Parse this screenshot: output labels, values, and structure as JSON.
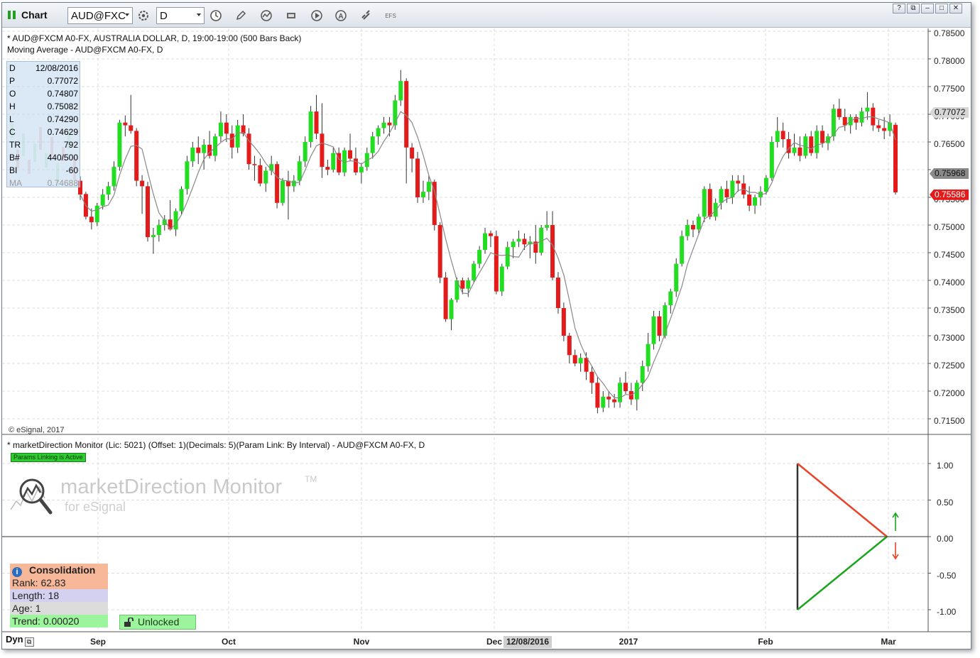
{
  "toolbar": {
    "title": "Chart",
    "symbol_value": "AUD@FXC",
    "interval_value": "D",
    "efs_label": "EFS"
  },
  "price_pane": {
    "header_line1": "* AUD@FXCM A0-FX, AUSTRALIA DOLLAR, D, 19:00-19:00 (500 Bars Back)",
    "header_line2": "Moving Average - AUD@FXCM A0-FX, D",
    "copyright": "© eSignal, 2017",
    "y_axis_labels": [
      "0.78500",
      "0.78000",
      "0.77500",
      "0.77000",
      "0.76500",
      "0.76000",
      "0.75500",
      "0.75000",
      "0.74500",
      "0.74000",
      "0.73500",
      "0.73000",
      "0.72500",
      "0.72000",
      "0.71500"
    ],
    "price_tags": [
      {
        "text": "0.77072",
        "bg": "#d6d6d6",
        "fg": "#111111"
      },
      {
        "text": "0.75968",
        "bg": "#8a8a8a",
        "fg": "#111111"
      },
      {
        "text": "0.75586",
        "bg": "#e41b1b",
        "fg": "#ffffff"
      }
    ]
  },
  "data_window": [
    {
      "k": "D",
      "v": "12/08/2016"
    },
    {
      "k": "P",
      "v": "0.77072"
    },
    {
      "k": "O",
      "v": "0.74807"
    },
    {
      "k": "H",
      "v": "0.75082"
    },
    {
      "k": "L",
      "v": "0.74290"
    },
    {
      "k": "C",
      "v": "0.74629"
    },
    {
      "k": "TR",
      "v": "792"
    },
    {
      "k": "B#",
      "v": "440/500"
    },
    {
      "k": "BI",
      "v": "-60"
    },
    {
      "k": "MA",
      "v": "0.74688"
    }
  ],
  "indicator_pane": {
    "header": "* marketDirection Monitor (Lic: 5021) (Offset: 1)(Decimals: 5)(Param Link: By Interval) - AUD@FXCM A0-FX, D",
    "badge": "Params Linking is Active",
    "logo_title": "marketDirection Monitor",
    "logo_tm": "TM",
    "logo_sub": "for eSignal",
    "y_axis_labels": [
      "1.00",
      "0.50",
      "0.00",
      "-0.50",
      "-1.00"
    ],
    "info_title": "Consolidation",
    "info_rows": [
      {
        "text": "Rank: 62.83",
        "bg": "#f7b89a"
      },
      {
        "text": "Length: 18",
        "bg": "#d4d0f0"
      },
      {
        "text": "Age: 1",
        "bg": "#dcdcdc"
      },
      {
        "text": "Trend: 0.00020",
        "bg": "#9cf59c"
      }
    ],
    "unlock_label": "Unlocked"
  },
  "x_axis": {
    "mode": "Dyn",
    "labels": [
      "Sep",
      "Oct",
      "Nov",
      "Dec",
      "2017",
      "Feb",
      "Mar"
    ],
    "crosshair_date": "12/08/2016"
  },
  "colors": {
    "up": "#22dd22",
    "down": "#e41b1b",
    "grid": "#dcdcdc"
  },
  "chart_data": {
    "type": "candlestick",
    "symbol": "AUD@FXCM A0-FX",
    "ylim": [
      0.713,
      0.787
    ],
    "ohlc": [
      [
        0.758,
        0.7588,
        0.7545,
        0.7555
      ],
      [
        0.7556,
        0.756,
        0.751,
        0.7515
      ],
      [
        0.7515,
        0.753,
        0.7492,
        0.7505
      ],
      [
        0.7505,
        0.754,
        0.7498,
        0.7535
      ],
      [
        0.7535,
        0.7565,
        0.7528,
        0.7555
      ],
      [
        0.7555,
        0.7578,
        0.7545,
        0.757
      ],
      [
        0.757,
        0.7615,
        0.7562,
        0.7605
      ],
      [
        0.7605,
        0.769,
        0.7598,
        0.7685
      ],
      [
        0.7685,
        0.7698,
        0.766,
        0.768
      ],
      [
        0.768,
        0.7735,
        0.7665,
        0.767
      ],
      [
        0.767,
        0.7675,
        0.757,
        0.758
      ],
      [
        0.758,
        0.759,
        0.752,
        0.757
      ],
      [
        0.757,
        0.7578,
        0.747,
        0.7478
      ],
      [
        0.7478,
        0.7495,
        0.7448,
        0.7482
      ],
      [
        0.7482,
        0.751,
        0.747,
        0.75
      ],
      [
        0.75,
        0.7518,
        0.749,
        0.751
      ],
      [
        0.751,
        0.7545,
        0.749,
        0.7492
      ],
      [
        0.7492,
        0.753,
        0.748,
        0.7525
      ],
      [
        0.7525,
        0.757,
        0.7518,
        0.7565
      ],
      [
        0.7565,
        0.7625,
        0.7555,
        0.7615
      ],
      [
        0.7615,
        0.765,
        0.7605,
        0.764
      ],
      [
        0.764,
        0.766,
        0.761,
        0.763
      ],
      [
        0.763,
        0.7655,
        0.76,
        0.7645
      ],
      [
        0.7645,
        0.767,
        0.762,
        0.7625
      ],
      [
        0.7625,
        0.7665,
        0.7615,
        0.766
      ],
      [
        0.766,
        0.7705,
        0.765,
        0.7685
      ],
      [
        0.7685,
        0.77,
        0.765,
        0.7665
      ],
      [
        0.7665,
        0.768,
        0.762,
        0.764
      ],
      [
        0.764,
        0.769,
        0.763,
        0.768
      ],
      [
        0.768,
        0.77,
        0.766,
        0.7665
      ],
      [
        0.7665,
        0.7675,
        0.76,
        0.761
      ],
      [
        0.761,
        0.7625,
        0.758,
        0.7608
      ],
      [
        0.7608,
        0.762,
        0.757,
        0.7575
      ],
      [
        0.7575,
        0.7605,
        0.756,
        0.7598
      ],
      [
        0.7598,
        0.7625,
        0.759,
        0.761
      ],
      [
        0.761,
        0.7615,
        0.753,
        0.754
      ],
      [
        0.754,
        0.7585,
        0.7535,
        0.758
      ],
      [
        0.758,
        0.7598,
        0.751,
        0.757
      ],
      [
        0.757,
        0.759,
        0.756,
        0.758
      ],
      [
        0.758,
        0.7625,
        0.7572,
        0.7615
      ],
      [
        0.7615,
        0.766,
        0.7605,
        0.765
      ],
      [
        0.765,
        0.7715,
        0.764,
        0.7705
      ],
      [
        0.7705,
        0.7735,
        0.7655,
        0.7665
      ],
      [
        0.7665,
        0.772,
        0.7585,
        0.7605
      ],
      [
        0.7605,
        0.7618,
        0.759,
        0.76
      ],
      [
        0.76,
        0.764,
        0.7595,
        0.763
      ],
      [
        0.763,
        0.764,
        0.759,
        0.7595
      ],
      [
        0.7595,
        0.764,
        0.7588,
        0.7635
      ],
      [
        0.7635,
        0.7665,
        0.7615,
        0.762
      ],
      [
        0.762,
        0.764,
        0.759,
        0.7595
      ],
      [
        0.7595,
        0.7612,
        0.7575,
        0.7605
      ],
      [
        0.7605,
        0.764,
        0.7598,
        0.763
      ],
      [
        0.763,
        0.7668,
        0.762,
        0.766
      ],
      [
        0.766,
        0.768,
        0.7645,
        0.7675
      ],
      [
        0.7675,
        0.7695,
        0.7665,
        0.7685
      ],
      [
        0.7685,
        0.7695,
        0.766,
        0.768
      ],
      [
        0.768,
        0.7735,
        0.7672,
        0.7725
      ],
      [
        0.7725,
        0.778,
        0.7715,
        0.776
      ],
      [
        0.776,
        0.7765,
        0.7575,
        0.764
      ],
      [
        0.764,
        0.7648,
        0.7595,
        0.762
      ],
      [
        0.762,
        0.7632,
        0.754,
        0.755
      ],
      [
        0.755,
        0.758,
        0.754,
        0.756
      ],
      [
        0.756,
        0.759,
        0.7545,
        0.7578
      ],
      [
        0.7578,
        0.7582,
        0.749,
        0.75
      ],
      [
        0.75,
        0.7505,
        0.7395,
        0.7405
      ],
      [
        0.7405,
        0.7415,
        0.7325,
        0.733
      ],
      [
        0.733,
        0.7368,
        0.731,
        0.7365
      ],
      [
        0.7365,
        0.7405,
        0.736,
        0.74
      ],
      [
        0.74,
        0.7405,
        0.7375,
        0.7385
      ],
      [
        0.7385,
        0.7405,
        0.737,
        0.74
      ],
      [
        0.74,
        0.7435,
        0.7395,
        0.743
      ],
      [
        0.743,
        0.7462,
        0.7422,
        0.7455
      ],
      [
        0.7455,
        0.7495,
        0.7448,
        0.7485
      ],
      [
        0.7485,
        0.749,
        0.746,
        0.748
      ],
      [
        0.748,
        0.749,
        0.7375,
        0.738
      ],
      [
        0.738,
        0.743,
        0.7372,
        0.7425
      ],
      [
        0.7425,
        0.747,
        0.742,
        0.746
      ],
      [
        0.746,
        0.7475,
        0.744,
        0.747
      ],
      [
        0.747,
        0.749,
        0.746,
        0.7475
      ],
      [
        0.7475,
        0.7485,
        0.7455,
        0.7465
      ],
      [
        0.7465,
        0.748,
        0.744,
        0.747
      ],
      [
        0.747,
        0.75,
        0.743,
        0.745
      ],
      [
        0.745,
        0.75,
        0.7445,
        0.7495
      ],
      [
        0.7495,
        0.7525,
        0.749,
        0.75
      ],
      [
        0.75,
        0.7525,
        0.74,
        0.7405
      ],
      [
        0.7405,
        0.7415,
        0.734,
        0.735
      ],
      [
        0.735,
        0.736,
        0.729,
        0.73
      ],
      [
        0.73,
        0.7305,
        0.725,
        0.7265
      ],
      [
        0.7265,
        0.7275,
        0.7245,
        0.725
      ],
      [
        0.725,
        0.7268,
        0.7235,
        0.726
      ],
      [
        0.726,
        0.727,
        0.722,
        0.7235
      ],
      [
        0.7235,
        0.7245,
        0.7195,
        0.7215
      ],
      [
        0.7215,
        0.7225,
        0.716,
        0.717
      ],
      [
        0.717,
        0.72,
        0.7162,
        0.719
      ],
      [
        0.719,
        0.72,
        0.717,
        0.7185
      ],
      [
        0.7185,
        0.7195,
        0.717,
        0.718
      ],
      [
        0.718,
        0.7225,
        0.717,
        0.7215
      ],
      [
        0.7215,
        0.7235,
        0.7195,
        0.72
      ],
      [
        0.72,
        0.7215,
        0.7175,
        0.7185
      ],
      [
        0.7185,
        0.722,
        0.7165,
        0.7215
      ],
      [
        0.7215,
        0.7255,
        0.72,
        0.7245
      ],
      [
        0.7245,
        0.7305,
        0.7235,
        0.7285
      ],
      [
        0.7285,
        0.7345,
        0.7275,
        0.7335
      ],
      [
        0.7335,
        0.7345,
        0.729,
        0.73
      ],
      [
        0.73,
        0.736,
        0.7295,
        0.7355
      ],
      [
        0.7355,
        0.7385,
        0.734,
        0.738
      ],
      [
        0.738,
        0.744,
        0.737,
        0.743
      ],
      [
        0.743,
        0.749,
        0.7425,
        0.748
      ],
      [
        0.748,
        0.751,
        0.7472,
        0.75
      ],
      [
        0.75,
        0.7508,
        0.7478,
        0.7492
      ],
      [
        0.7492,
        0.752,
        0.7485,
        0.7515
      ],
      [
        0.7515,
        0.757,
        0.7505,
        0.7565
      ],
      [
        0.7565,
        0.7575,
        0.751,
        0.7515
      ],
      [
        0.7515,
        0.7548,
        0.7508,
        0.754
      ],
      [
        0.754,
        0.757,
        0.7528,
        0.7565
      ],
      [
        0.7565,
        0.758,
        0.754,
        0.755
      ],
      [
        0.755,
        0.759,
        0.7538,
        0.758
      ],
      [
        0.758,
        0.759,
        0.756,
        0.7575
      ],
      [
        0.7575,
        0.759,
        0.7548,
        0.7555
      ],
      [
        0.7555,
        0.757,
        0.7525,
        0.7535
      ],
      [
        0.7535,
        0.7555,
        0.752,
        0.755
      ],
      [
        0.755,
        0.757,
        0.7535,
        0.756
      ],
      [
        0.756,
        0.759,
        0.7555,
        0.7585
      ],
      [
        0.7585,
        0.766,
        0.758,
        0.765
      ],
      [
        0.765,
        0.7695,
        0.764,
        0.767
      ],
      [
        0.767,
        0.7685,
        0.764,
        0.7655
      ],
      [
        0.7655,
        0.7668,
        0.762,
        0.763
      ],
      [
        0.763,
        0.7665,
        0.7625,
        0.764
      ],
      [
        0.764,
        0.766,
        0.7615,
        0.7625
      ],
      [
        0.7625,
        0.7665,
        0.762,
        0.766
      ],
      [
        0.766,
        0.767,
        0.7625,
        0.763
      ],
      [
        0.763,
        0.768,
        0.762,
        0.767
      ],
      [
        0.767,
        0.768,
        0.764,
        0.7648
      ],
      [
        0.7648,
        0.7665,
        0.7635,
        0.766
      ],
      [
        0.766,
        0.7718,
        0.7652,
        0.771
      ],
      [
        0.771,
        0.7728,
        0.769,
        0.7695
      ],
      [
        0.7695,
        0.771,
        0.767,
        0.768
      ],
      [
        0.768,
        0.77,
        0.7665,
        0.7695
      ],
      [
        0.7695,
        0.77,
        0.7672,
        0.7685
      ],
      [
        0.7685,
        0.7712,
        0.7678,
        0.7705
      ],
      [
        0.7705,
        0.774,
        0.769,
        0.7712
      ],
      [
        0.7712,
        0.772,
        0.767,
        0.768
      ],
      [
        0.768,
        0.769,
        0.7668,
        0.7675
      ],
      [
        0.7675,
        0.7695,
        0.7655,
        0.767
      ],
      [
        0.767,
        0.77,
        0.766,
        0.7685
      ],
      [
        0.7681,
        0.7685,
        0.7555,
        0.7559
      ]
    ],
    "moving_average_last": 0.75968
  }
}
